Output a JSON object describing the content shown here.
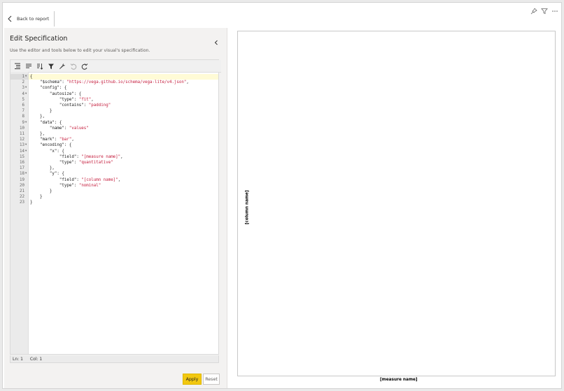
{
  "header": {
    "back_label": "Back to report"
  },
  "panel": {
    "title": "Edit Specification",
    "description": "Use the editor and tools below to edit your visual's specification."
  },
  "toolbar": {
    "tools": [
      "format-icon",
      "compact-icon",
      "sort-icon",
      "filter-icon",
      "repair-icon",
      "undo-icon",
      "redo-icon"
    ]
  },
  "editor": {
    "line_numbers": [
      "1",
      "2",
      "3",
      "4",
      "5",
      "6",
      "7",
      "8",
      "9",
      "10",
      "11",
      "12",
      "13",
      "14",
      "15",
      "16",
      "17",
      "18",
      "19",
      "20",
      "21",
      "22",
      "23"
    ],
    "code": {
      "l1": "{",
      "l2_key": "\"$schema\"",
      "l2_val": "\"https://vega.github.io/schema/vega-lite/v4.json\"",
      "l3_key": "\"config\"",
      "l4_key": "\"autosize\"",
      "l5_key": "\"type\"",
      "l5_val": "\"fit\"",
      "l6_key": "\"contains\"",
      "l6_val": "\"padding\"",
      "l7": "}",
      "l8": "},",
      "l9_key": "\"data\"",
      "l10_key": "\"name\"",
      "l10_val": "\"values\"",
      "l11": "},",
      "l12_key": "\"mark\"",
      "l12_val": "\"bar\"",
      "l13_key": "\"encoding\"",
      "l14_key": "\"x\"",
      "l15_key": "\"field\"",
      "l15_val": "\"[measure name]\"",
      "l16_key": "\"type\"",
      "l16_val": "\"quantitative\"",
      "l17": "},",
      "l18_key": "\"y\"",
      "l19_key": "\"field\"",
      "l19_val": "\"[column name]\"",
      "l20_key": "\"type\"",
      "l20_val": "\"nominal\"",
      "l21": "}",
      "l22": "}",
      "l23": "}"
    }
  },
  "status": {
    "line": "Ln: 1",
    "col": "Col: 1"
  },
  "buttons": {
    "apply": "Apply",
    "reset": "Reset"
  },
  "preview": {
    "y_axis_title": "[column name]",
    "x_axis_title": "[measure name]"
  },
  "colors": {
    "apply": "#f2c811",
    "string": "#c41a3a",
    "active_line": "#fffbd6"
  }
}
